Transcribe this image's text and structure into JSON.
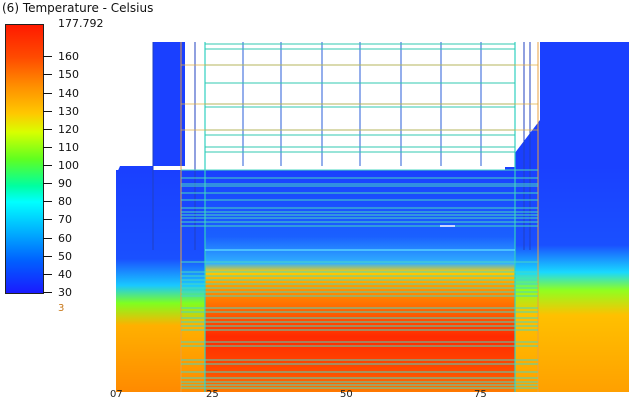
{
  "chart_data": {
    "type": "heatmap",
    "title": "(6) Temperature - Celsius",
    "colorbar": {
      "max_label": "177.792",
      "ticks": [
        160,
        150,
        140,
        130,
        120,
        110,
        100,
        90,
        80,
        70,
        60,
        50,
        40,
        30
      ],
      "range": [
        30,
        177.792
      ],
      "below_label": "3"
    },
    "x_ticks": [
      {
        "label": "07",
        "value": 7
      },
      {
        "label": "25",
        "value": 25
      },
      {
        "label": "50",
        "value": 50
      },
      {
        "label": "75",
        "value": 75
      }
    ],
    "x_range": [
      7,
      90
    ]
  }
}
